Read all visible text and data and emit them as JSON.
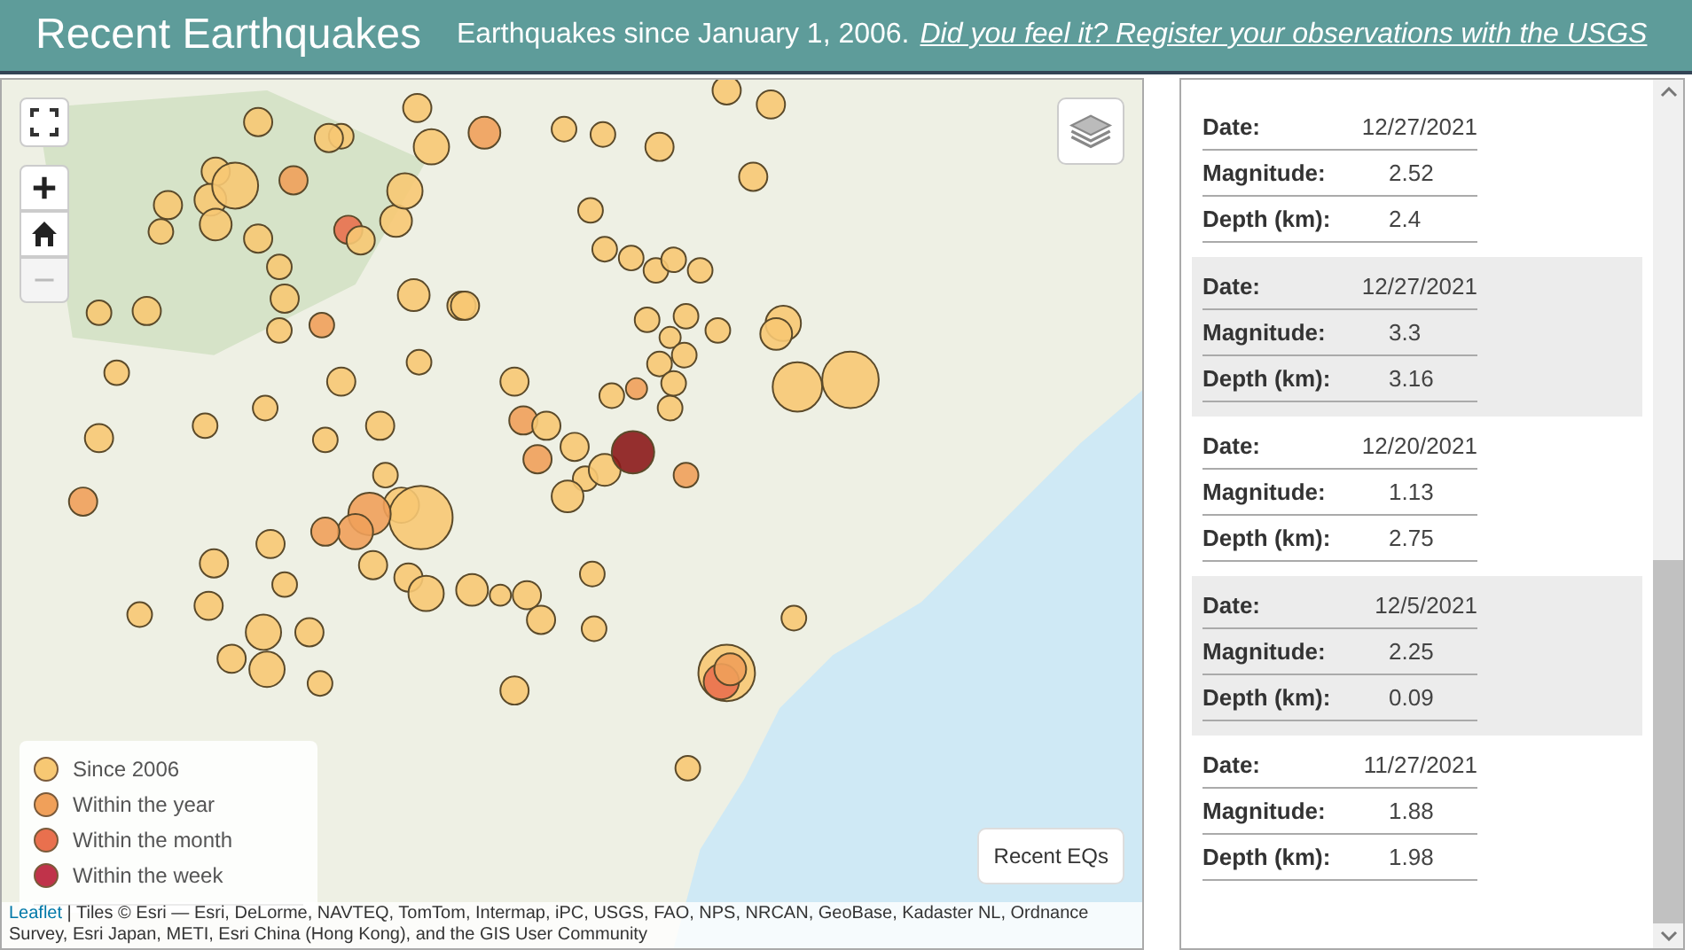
{
  "header": {
    "title": "Recent Earthquakes",
    "subtitle": "Earthquakes since January 1, 2006.",
    "link": "Did you feel it? Register your observations with the USGS"
  },
  "map": {
    "controls": [
      {
        "kind": "fullscreen",
        "disabled": false
      },
      {
        "kind": "zoom-in",
        "disabled": false
      },
      {
        "kind": "home",
        "disabled": false
      },
      {
        "kind": "zoom-out",
        "disabled": true
      }
    ],
    "legend": [
      {
        "label": "Since 2006",
        "color": "#f7c873"
      },
      {
        "label": "Within the year",
        "color": "#f0a05a"
      },
      {
        "label": "Within the month",
        "color": "#e9704e"
      },
      {
        "label": "Within the week",
        "color": "#c0334a"
      }
    ],
    "recent_button": "Recent EQs",
    "attribution": {
      "link": "Leaflet",
      "text": "| Tiles © Esri — Esri, DeLorme, NAVTEQ, TomTom, Intermap, iPC, USGS, FAO, NPS, NRCAN, GeoBase, Kadaster NL, Ordnance Survey, Esri Japan, METI, Esri China (Hong Kong), and the GIS User Community"
    }
  },
  "list": {
    "entries": [
      {
        "date_label": "Date:",
        "date": "12/27/2021",
        "magnitude_label": "Magnitude:",
        "magnitude": "2.52",
        "depth_label": "Depth (km):",
        "depth": "2.4"
      },
      {
        "date_label": "Date:",
        "date": "12/27/2021",
        "magnitude_label": "Magnitude:",
        "magnitude": "3.3",
        "depth_label": "Depth (km):",
        "depth": "3.16"
      },
      {
        "date_label": "Date:",
        "date": "12/20/2021",
        "magnitude_label": "Magnitude:",
        "magnitude": "1.13",
        "depth_label": "Depth (km):",
        "depth": "2.75"
      },
      {
        "date_label": "Date:",
        "date": "12/5/2021",
        "magnitude_label": "Magnitude:",
        "magnitude": "2.25",
        "depth_label": "Depth (km):",
        "depth": "0.09"
      },
      {
        "date_label": "Date:",
        "date": "11/27/2021",
        "magnitude_label": "Magnitude:",
        "magnitude": "1.88",
        "depth_label": "Depth (km):",
        "depth": "1.98"
      }
    ]
  }
}
